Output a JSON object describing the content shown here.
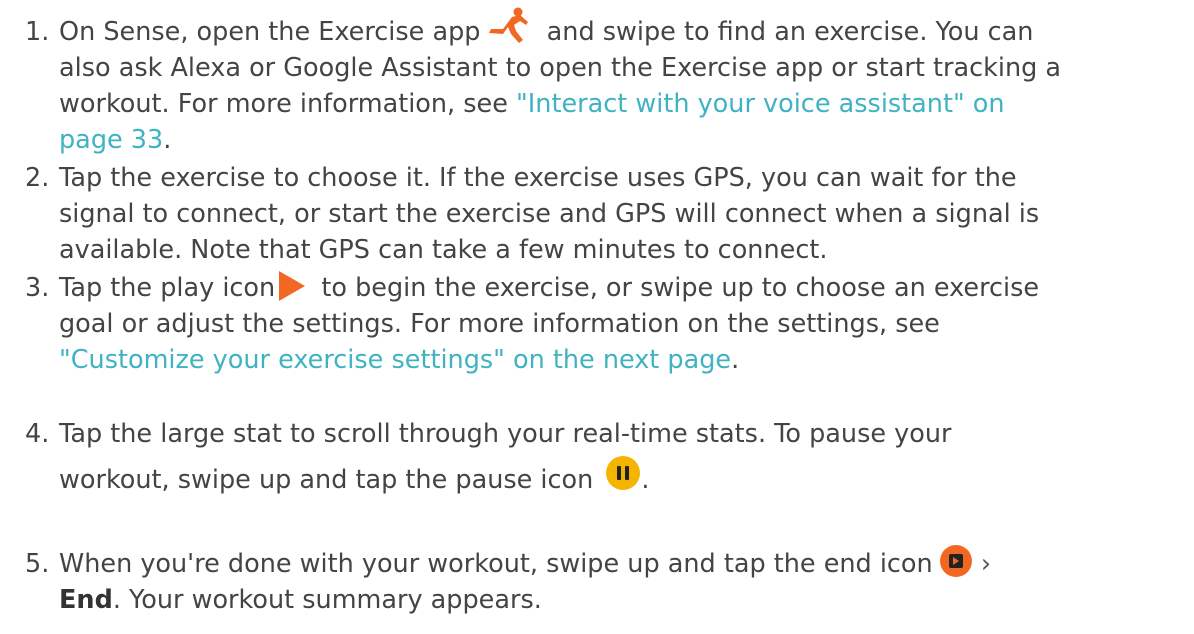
{
  "steps": [
    {
      "number": "1.",
      "lines": [
        [
          "On Sense, open the Exercise app ",
          " and swipe to find an exercise. You can"
        ],
        "also ask Alexa or Google Assistant to open the Exercise app or start tracking a",
        [
          "workout. For more information, see ",
          "\"Interact with your voice assistant\" on"
        ],
        [
          "page 33",
          "."
        ]
      ],
      "icon": "runner-icon"
    },
    {
      "number": "2.",
      "lines": [
        "Tap the exercise to choose it. If the exercise uses GPS, you can wait for the",
        "signal to connect, or start the exercise and GPS will connect when a signal is",
        "available. Note that GPS can take a few minutes to connect."
      ]
    },
    {
      "number": "3.",
      "lines": [
        [
          "Tap the play icon ",
          " to begin the exercise, or swipe up to choose an exercise"
        ],
        "goal or adjust the settings. For more information on the settings, see",
        [
          "\"Customize your exercise settings\" on the next page",
          "."
        ]
      ],
      "icon": "play-icon"
    },
    {
      "number": "4.",
      "lines": [
        "Tap the large stat to scroll through your real-time stats. To pause your",
        [
          "workout, swipe up and tap the pause icon ",
          "."
        ]
      ],
      "icon": "pause-icon"
    },
    {
      "number": "5.",
      "lines": [
        [
          "When you're done with your workout, swipe up and tap the end icon ",
          " ›"
        ],
        [
          "End",
          ". Your workout summary appears."
        ]
      ],
      "icon": "end-icon"
    }
  ],
  "colors": {
    "text": "#444444",
    "link": "#3fb3c2",
    "orange": "#f26722",
    "yellow": "#f5b400"
  }
}
